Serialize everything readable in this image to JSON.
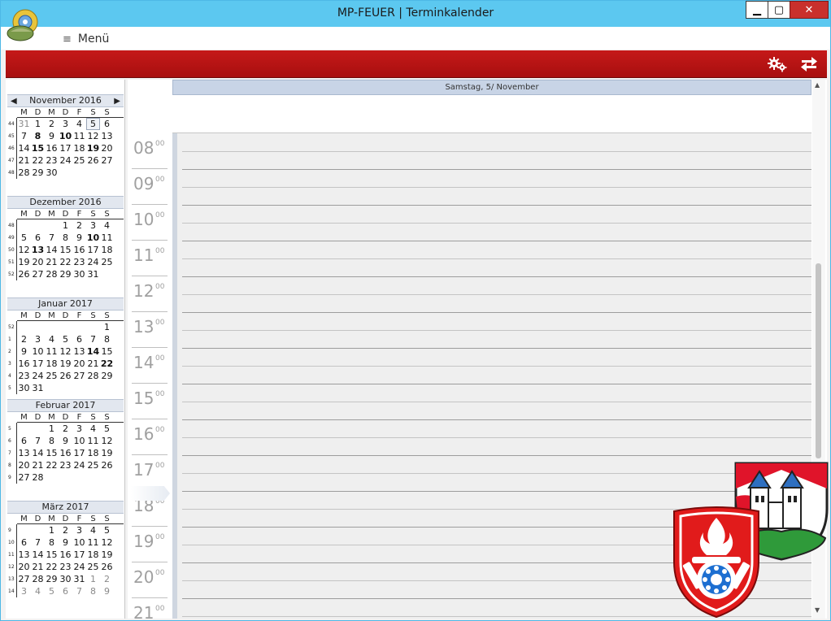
{
  "window": {
    "title": "MP-FEUER | Terminkalender",
    "minimize_label": "▁",
    "maximize_label": "▢",
    "close_label": "✕"
  },
  "menu": {
    "icon": "≡",
    "label": "Menü"
  },
  "ribbon": {
    "settings_icon": "gear-icon",
    "sync_icon": "swap-arrows-icon"
  },
  "mini_calendars": {
    "weekday_headers": [
      "M",
      "D",
      "M",
      "D",
      "F",
      "S",
      "S"
    ],
    "months": [
      {
        "title": "November 2016",
        "weeks": [
          {
            "num": "44",
            "days": [
              "31",
              "1",
              "2",
              "3",
              "4",
              "5",
              "6"
            ]
          },
          {
            "num": "45",
            "days": [
              "7",
              "8",
              "9",
              "10",
              "11",
              "12",
              "13"
            ]
          },
          {
            "num": "46",
            "days": [
              "14",
              "15",
              "16",
              "17",
              "18",
              "19",
              "20"
            ]
          },
          {
            "num": "47",
            "days": [
              "21",
              "22",
              "23",
              "24",
              "25",
              "26",
              "27"
            ]
          },
          {
            "num": "48",
            "days": [
              "28",
              "29",
              "30",
              "",
              "",
              "",
              ""
            ]
          }
        ]
      },
      {
        "title": "Dezember 2016",
        "weeks": [
          {
            "num": "48",
            "days": [
              "",
              "",
              "",
              "1",
              "2",
              "3",
              "4"
            ]
          },
          {
            "num": "49",
            "days": [
              "5",
              "6",
              "7",
              "8",
              "9",
              "10",
              "11"
            ]
          },
          {
            "num": "50",
            "days": [
              "12",
              "13",
              "14",
              "15",
              "16",
              "17",
              "18"
            ]
          },
          {
            "num": "51",
            "days": [
              "19",
              "20",
              "21",
              "22",
              "23",
              "24",
              "25"
            ]
          },
          {
            "num": "52",
            "days": [
              "26",
              "27",
              "28",
              "29",
              "30",
              "31",
              ""
            ]
          }
        ]
      },
      {
        "title": "Januar 2017",
        "weeks": [
          {
            "num": "52",
            "days": [
              "",
              "",
              "",
              "",
              "",
              "",
              "1"
            ]
          },
          {
            "num": "1",
            "days": [
              "2",
              "3",
              "4",
              "5",
              "6",
              "7",
              "8"
            ]
          },
          {
            "num": "2",
            "days": [
              "9",
              "10",
              "11",
              "12",
              "13",
              "14",
              "15"
            ]
          },
          {
            "num": "3",
            "days": [
              "16",
              "17",
              "18",
              "19",
              "20",
              "21",
              "22"
            ]
          },
          {
            "num": "4",
            "days": [
              "23",
              "24",
              "25",
              "26",
              "27",
              "28",
              "29"
            ]
          },
          {
            "num": "5",
            "days": [
              "30",
              "31",
              "",
              "",
              "",
              "",
              ""
            ]
          }
        ]
      },
      {
        "title": "Februar 2017",
        "weeks": [
          {
            "num": "5",
            "days": [
              "",
              "",
              "1",
              "2",
              "3",
              "4",
              "5"
            ]
          },
          {
            "num": "6",
            "days": [
              "6",
              "7",
              "8",
              "9",
              "10",
              "11",
              "12"
            ]
          },
          {
            "num": "7",
            "days": [
              "13",
              "14",
              "15",
              "16",
              "17",
              "18",
              "19"
            ]
          },
          {
            "num": "8",
            "days": [
              "20",
              "21",
              "22",
              "23",
              "24",
              "25",
              "26"
            ]
          },
          {
            "num": "9",
            "days": [
              "27",
              "28",
              "",
              "",
              "",
              "",
              ""
            ]
          }
        ]
      },
      {
        "title": "März 2017",
        "weeks": [
          {
            "num": "9",
            "days": [
              "",
              "",
              "1",
              "2",
              "3",
              "4",
              "5"
            ]
          },
          {
            "num": "10",
            "days": [
              "6",
              "7",
              "8",
              "9",
              "10",
              "11",
              "12"
            ]
          },
          {
            "num": "11",
            "days": [
              "13",
              "14",
              "15",
              "16",
              "17",
              "18",
              "19"
            ]
          },
          {
            "num": "12",
            "days": [
              "20",
              "21",
              "22",
              "23",
              "24",
              "25",
              "26"
            ]
          },
          {
            "num": "13",
            "days": [
              "27",
              "28",
              "29",
              "30",
              "31",
              "1",
              "2"
            ]
          },
          {
            "num": "14",
            "days": [
              "3",
              "4",
              "5",
              "6",
              "7",
              "8",
              "9"
            ]
          }
        ]
      }
    ]
  },
  "day_view": {
    "header": "Samstag, 5/ November",
    "hours": [
      "08",
      "09",
      "10",
      "11",
      "12",
      "13",
      "14",
      "15",
      "16",
      "17",
      "18",
      "19",
      "20",
      "21"
    ],
    "minutes": "00"
  },
  "colors": {
    "titlebar": "#5cc8f0",
    "ribbon": "#b81414",
    "day_header": "#c8d4e6"
  }
}
